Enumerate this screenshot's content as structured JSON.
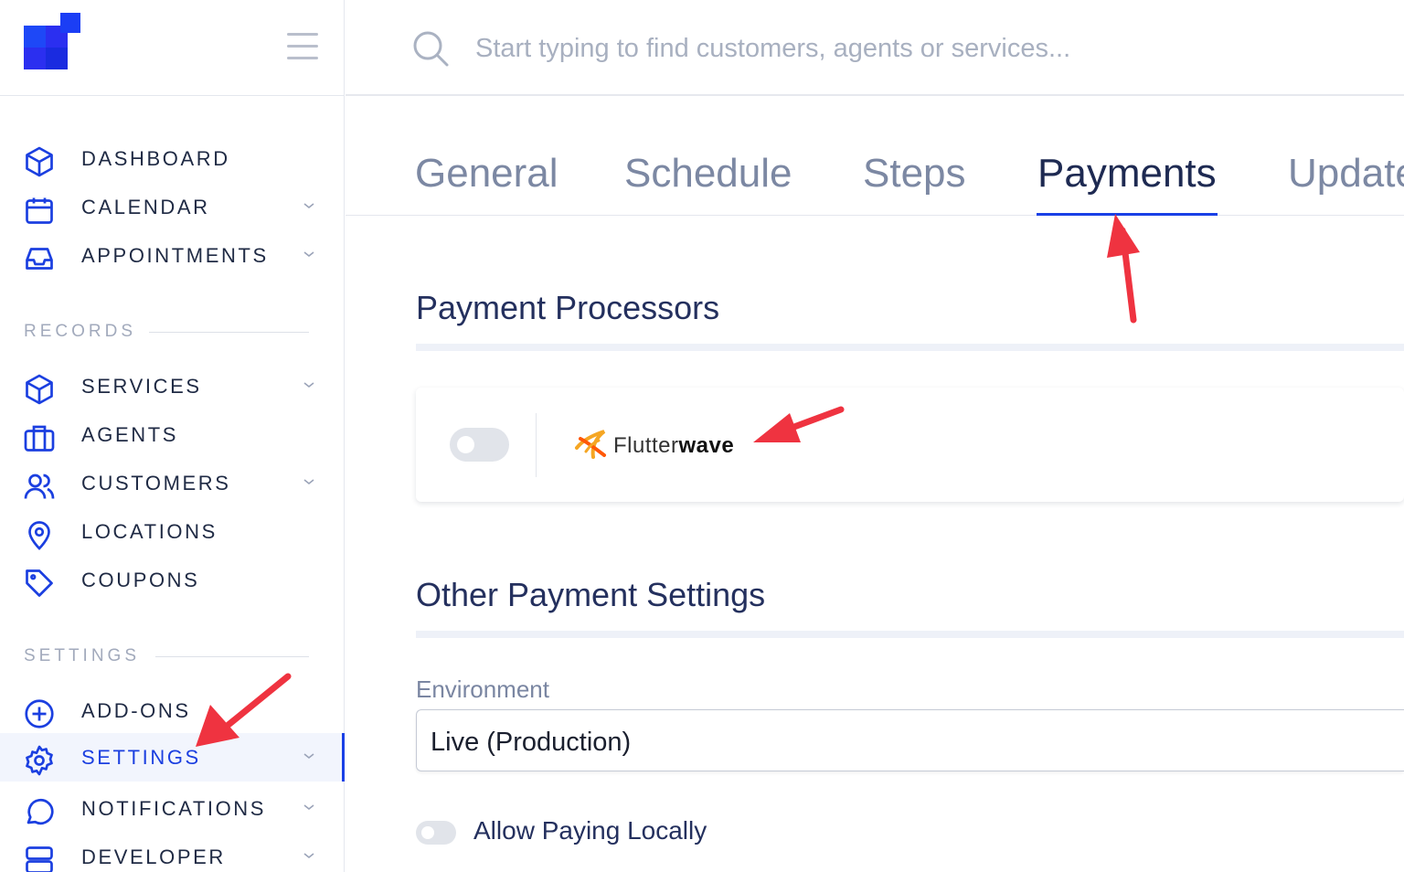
{
  "search": {
    "placeholder": "Start typing to find customers, agents or services..."
  },
  "sidebar": {
    "main_items": [
      {
        "label": "DASHBOARD",
        "icon": "cube-icon",
        "has_chevron": false
      },
      {
        "label": "CALENDAR",
        "icon": "calendar-icon",
        "has_chevron": true
      },
      {
        "label": "APPOINTMENTS",
        "icon": "inbox-icon",
        "has_chevron": true
      }
    ],
    "records_heading": "RECORDS",
    "records_items": [
      {
        "label": "SERVICES",
        "icon": "cube-icon",
        "has_chevron": true
      },
      {
        "label": "AGENTS",
        "icon": "briefcase-icon",
        "has_chevron": false
      },
      {
        "label": "CUSTOMERS",
        "icon": "users-icon",
        "has_chevron": true
      },
      {
        "label": "LOCATIONS",
        "icon": "map-pin-icon",
        "has_chevron": false
      },
      {
        "label": "COUPONS",
        "icon": "tag-icon",
        "has_chevron": false
      }
    ],
    "settings_heading": "SETTINGS",
    "settings_items": [
      {
        "label": "ADD-ONS",
        "icon": "plus-circle-icon",
        "has_chevron": false
      },
      {
        "label": "SETTINGS",
        "icon": "gear-icon",
        "has_chevron": true,
        "active": true
      },
      {
        "label": "NOTIFICATIONS",
        "icon": "chat-bubble-icon",
        "has_chevron": true
      },
      {
        "label": "DEVELOPER",
        "icon": "server-icon",
        "has_chevron": true
      }
    ]
  },
  "tabs": [
    {
      "label": "General"
    },
    {
      "label": "Schedule"
    },
    {
      "label": "Steps"
    },
    {
      "label": "Payments",
      "active": true
    },
    {
      "label": "Update"
    }
  ],
  "payment_processors": {
    "title": "Payment Processors",
    "processor": {
      "name_light": "Flutter",
      "name_bold": "wave",
      "enabled": false
    }
  },
  "other_settings": {
    "title": "Other Payment Settings",
    "environment_label": "Environment",
    "environment_value": "Live (Production)",
    "allow_paying_locally_label": "Allow Paying Locally",
    "allow_paying_locally_enabled": false
  },
  "colors": {
    "accent": "#1a40e6",
    "annotation_arrow": "#ef3340",
    "flutterwave_orange": "#f5a623"
  }
}
